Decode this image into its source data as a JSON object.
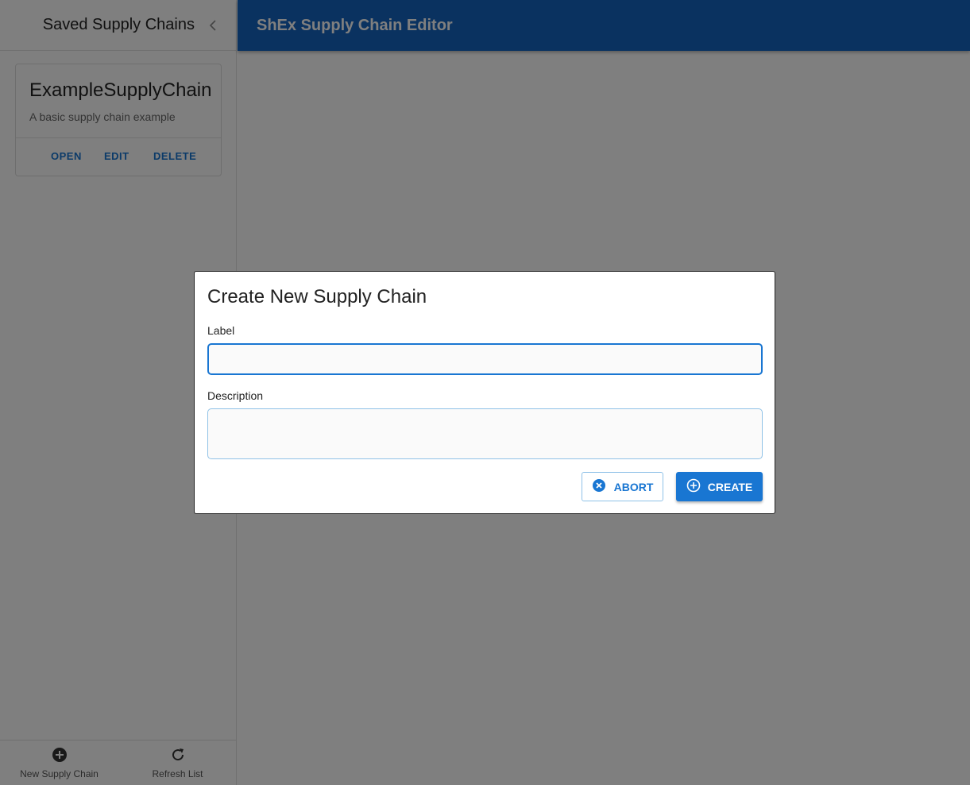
{
  "sidebar": {
    "title": "Saved Supply Chains",
    "collapse_icon": "chevron-left-icon",
    "cards": [
      {
        "title": "ExampleSupplyChain",
        "description": "A basic supply chain example",
        "actions": {
          "open": "OPEN",
          "edit": "EDIT",
          "delete": "DELETE"
        }
      }
    ],
    "footer": {
      "new_label": "New Supply Chain",
      "new_icon": "add-circle-icon",
      "refresh_label": "Refresh List",
      "refresh_icon": "refresh-icon"
    }
  },
  "appbar": {
    "title": "ShEx Supply Chain Editor",
    "color": "#1565c0"
  },
  "dialog": {
    "title": "Create New Supply Chain",
    "label_field": {
      "label": "Label",
      "value": ""
    },
    "description_field": {
      "label": "Description",
      "value": ""
    },
    "abort_label": "ABORT",
    "abort_icon": "cancel-circle-icon",
    "create_label": "CREATE",
    "create_icon": "add-circle-outline-icon",
    "accent": "#1976d2"
  }
}
